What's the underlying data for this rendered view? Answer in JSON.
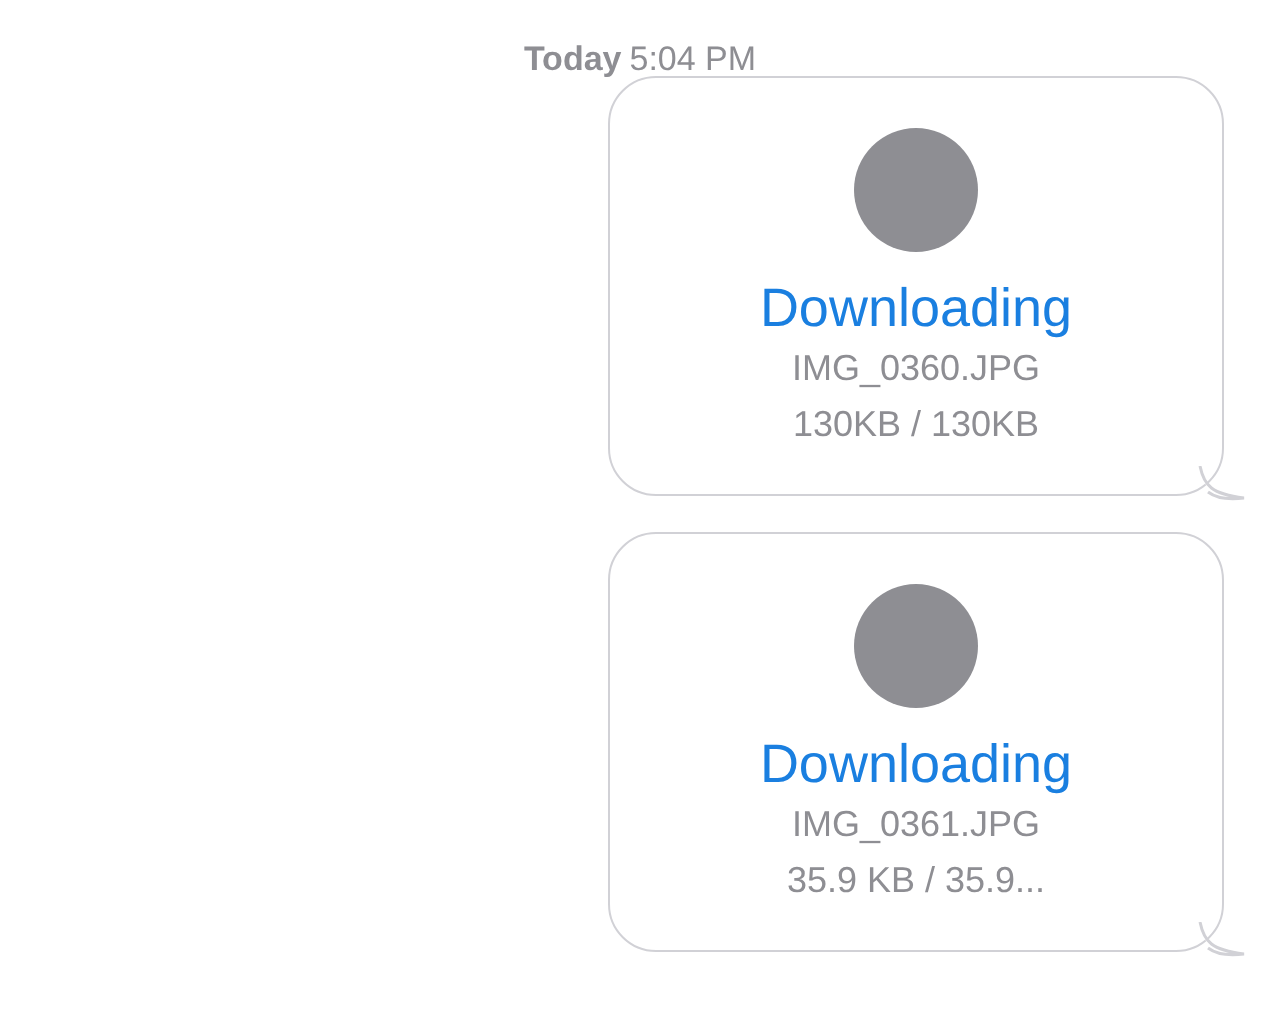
{
  "timestamp": {
    "day": "Today",
    "time": "5:04 PM"
  },
  "messages": [
    {
      "status": "Downloading",
      "filename": "IMG_0360.JPG",
      "size": "130KB / 130KB"
    },
    {
      "status": "Downloading",
      "filename": "IMG_0361.JPG",
      "size": "35.9 KB / 35.9..."
    }
  ]
}
